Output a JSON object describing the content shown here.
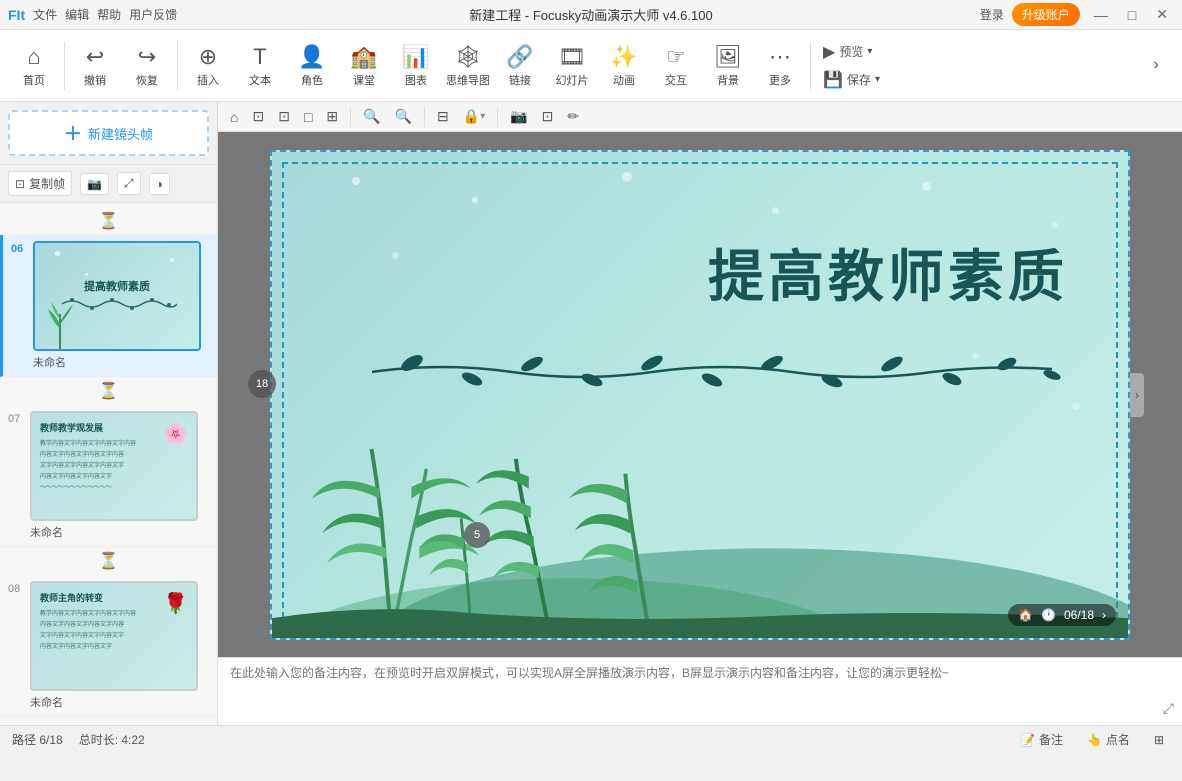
{
  "titlebar": {
    "app_name": "新建工程 - Focusky动画演示大师 v4.6.100",
    "logo_text": "FIt",
    "login_label": "登录",
    "upgrade_label": "升级账户",
    "minimize": "—",
    "maximize": "□",
    "close": "✕"
  },
  "menubar": {
    "items": [
      "文件",
      "编辑",
      "帮助",
      "用户反馈"
    ]
  },
  "toolbar": {
    "home_label": "首页",
    "undo_label": "撤销",
    "redo_label": "恢复",
    "insert_label": "插入",
    "text_label": "文本",
    "role_label": "角色",
    "classroom_label": "课堂",
    "chart_label": "图表",
    "mindmap_label": "思维导图",
    "link_label": "链接",
    "slide_label": "幻灯片",
    "animation_label": "动画",
    "interact_label": "交互",
    "background_label": "背景",
    "more_label": "更多",
    "preview_label": "预览",
    "save_label": "保存"
  },
  "sidebar": {
    "new_frame_label": "新建镜头帧",
    "copy_frame_label": "复制帧",
    "slides": [
      {
        "num": "06",
        "name": "未命名",
        "active": true,
        "thumb_title": "提高教师素质",
        "thumb_branch": "~~~~~~~~~~~~~~~~~~"
      },
      {
        "num": "07",
        "name": "未命名",
        "active": false,
        "thumb_title": "教师教学观发展",
        "thumb_lines": [
          "教学内容文字内容文字内容文字内容文字",
          "内容文字内容文字内容文字内容文字内容"
        ]
      },
      {
        "num": "08",
        "name": "未命名",
        "active": false,
        "thumb_title": "教师主角的转变",
        "thumb_lines": [
          "教学内容文字内容文字内容文字内容文字",
          "内容文字内容文字内容文字内容文字内容"
        ]
      }
    ]
  },
  "canvas": {
    "toolbar_icons": [
      "🏠",
      "⊡",
      "⊡",
      "□",
      "⊞",
      "🔍",
      "🔍",
      "⊟",
      "⊟",
      "▶",
      "◀",
      "✏"
    ],
    "slide_main_title": "提高教师素质",
    "badge_text": "06/18",
    "left_badge": "18",
    "left_badge2": "5"
  },
  "notes": {
    "placeholder": "在此处输入您的备注内容，在预览时开启双屏模式，可以实现A屏全屏播放演示内容，B屏显示演示内容和备注内容，让您的演示更轻松~"
  },
  "statusbar": {
    "path_label": "路径 6/18",
    "duration_label": "总时长: 4:22",
    "notes_label": "备注",
    "pointer_label": "点名",
    "screen_label": "⊞"
  },
  "colors": {
    "accent_blue": "#2196F3",
    "bg_slide": "#a8d8d8",
    "title_dark": "#1a5555",
    "upgrade_bg": "#ff8c00"
  }
}
